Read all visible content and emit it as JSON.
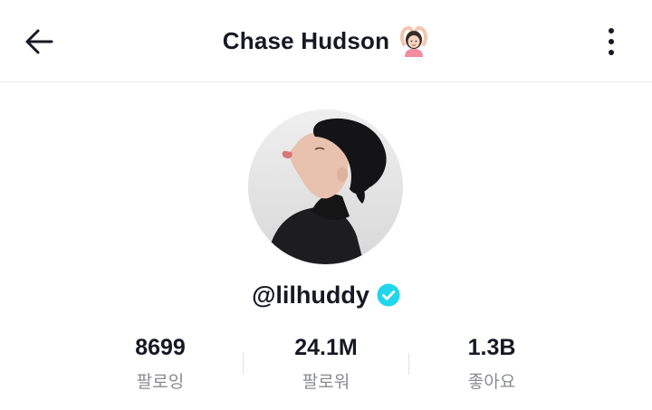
{
  "header": {
    "back_icon": "arrow-left-icon",
    "title": "Chase Hudson",
    "title_emoji": "woman-gesturing-ok-emoji",
    "more_icon": "vertical-ellipsis-icon"
  },
  "profile": {
    "avatar_alt": "profile photo",
    "username": "@lilhuddy",
    "verified_icon": "verified-badge-icon",
    "verified_color": "#20D5EC"
  },
  "stats": [
    {
      "value": "8699",
      "label": "팔로잉"
    },
    {
      "value": "24.1M",
      "label": "팔로워"
    },
    {
      "value": "1.3B",
      "label": "좋아요"
    }
  ]
}
